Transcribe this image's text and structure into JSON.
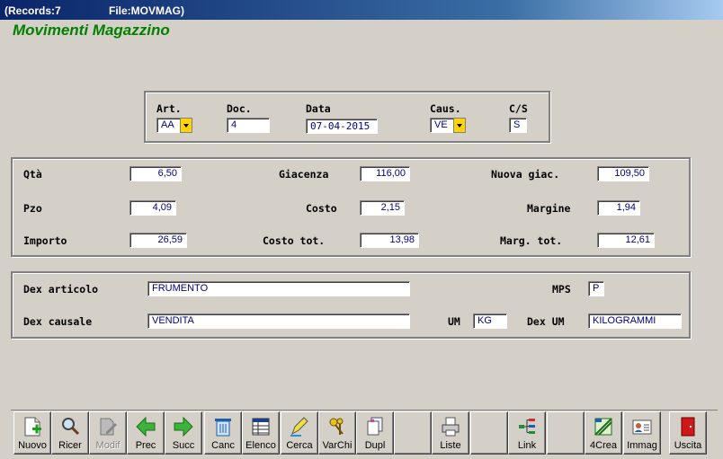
{
  "window": {
    "records": "(Records:7",
    "file": "File:MOVMAG)"
  },
  "app_title": "Movimenti Magazzino",
  "header": {
    "art": {
      "label": "Art.",
      "value": "AA"
    },
    "doc": {
      "label": "Doc.",
      "value": "4"
    },
    "data": {
      "label": "Data",
      "value": "07-04-2015"
    },
    "caus": {
      "label": "Caus.",
      "value": "VE"
    },
    "cs": {
      "label": "C/S",
      "value": "S"
    }
  },
  "values": {
    "qta": {
      "label": "Qtà",
      "value": "6,50"
    },
    "giacenza": {
      "label": "Giacenza",
      "value": "116,00"
    },
    "nuova_giac": {
      "label": "Nuova giac.",
      "value": "109,50"
    },
    "pzo": {
      "label": "Pzo",
      "value": "4,09"
    },
    "costo": {
      "label": "Costo",
      "value": "2,15"
    },
    "margine": {
      "label": "Margine",
      "value": "1,94"
    },
    "importo": {
      "label": "Importo",
      "value": "26,59"
    },
    "costo_tot": {
      "label": "Costo tot.",
      "value": "13,98"
    },
    "marg_tot": {
      "label": "Marg. tot.",
      "value": "12,61"
    }
  },
  "descriptions": {
    "dex_articolo": {
      "label": "Dex articolo",
      "value": "FRUMENTO"
    },
    "mps": {
      "label": "MPS",
      "value": "P"
    },
    "dex_causale": {
      "label": "Dex causale",
      "value": "VENDITA"
    },
    "um": {
      "label": "UM",
      "value": "KG"
    },
    "dex_um": {
      "label": "Dex UM",
      "value": "KILOGRAMMI"
    }
  },
  "toolbar": {
    "nuovo": "Nuovo",
    "ricer": "Ricer",
    "modif": "Modif",
    "prec": "Prec",
    "succ": "Succ",
    "canc": "Canc",
    "elenco": "Elenco",
    "cerca": "Cerca",
    "varchi": "VarChi",
    "dupl": "Dupl",
    "liste": "Liste",
    "link": "Link",
    "crea4": "4Crea",
    "immag": "Immag",
    "uscita": "Uscita"
  }
}
